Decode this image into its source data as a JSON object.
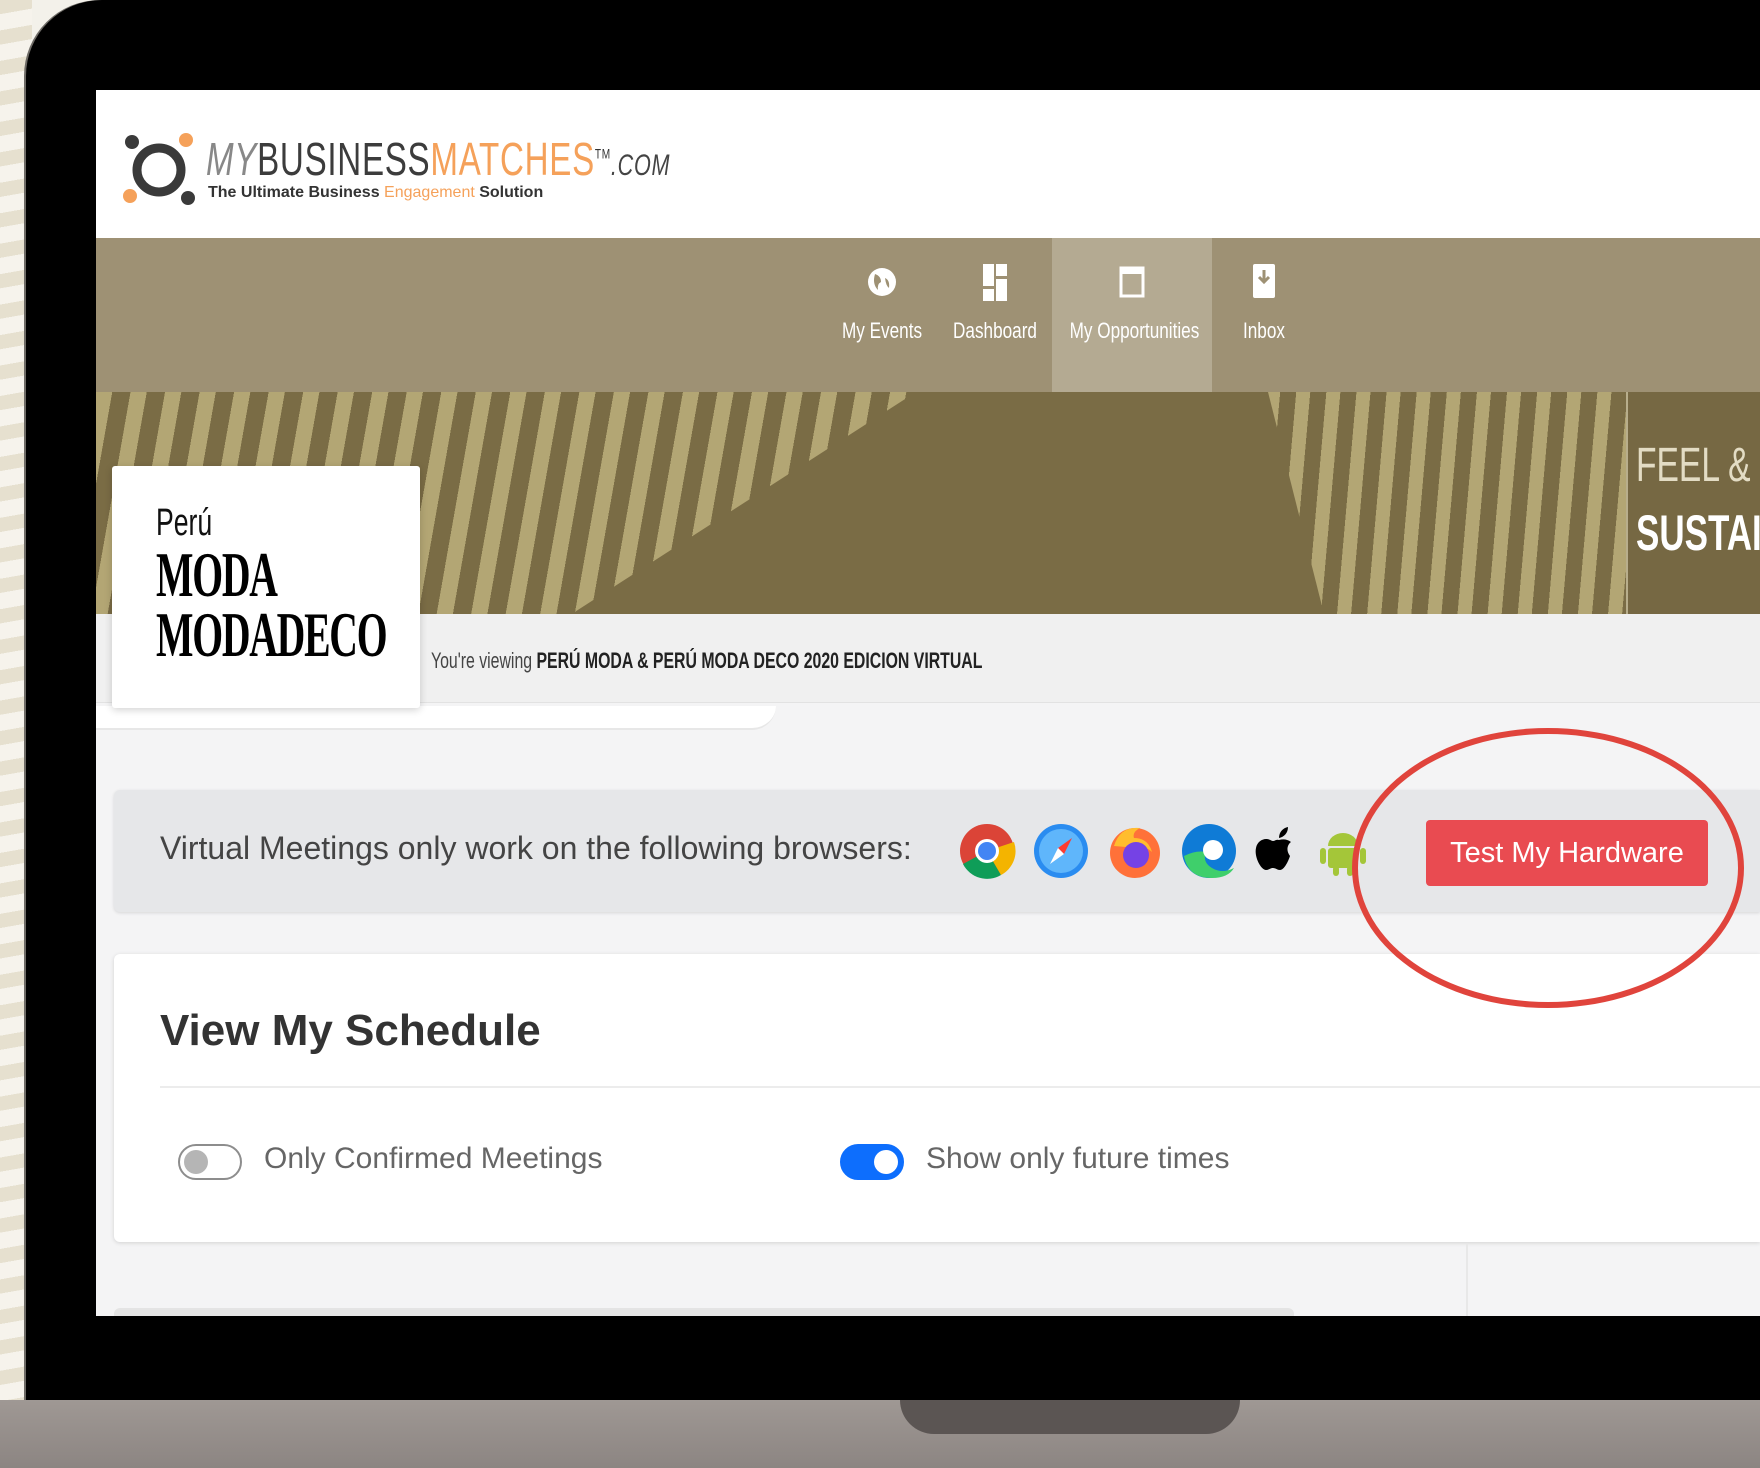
{
  "header": {
    "logo_my": "MY",
    "logo_business": "BUSINESS",
    "logo_matches": "MATCHES",
    "logo_tm": "TM",
    "logo_com": ".COM",
    "tagline_a": "The Ultimate Business ",
    "tagline_b": "Engagement",
    "tagline_c": " Solution"
  },
  "nav": {
    "items": [
      {
        "label": "My Events",
        "icon": "globe-icon"
      },
      {
        "label": "Dashboard",
        "icon": "dashboard-icon"
      },
      {
        "label": "My Opportunities",
        "icon": "folder-icon",
        "active": true
      },
      {
        "label": "Inbox",
        "icon": "inbox-icon"
      }
    ]
  },
  "banner": {
    "line1": "FEEL &",
    "line2": "SUSTAI"
  },
  "event": {
    "logo_line1": "Perú",
    "logo_line2": "MODA",
    "logo_line3": "MODADECO",
    "viewing_prefix": "You're viewing ",
    "viewing_name": "PERÚ MODA & PERÚ MODA DECO 2020 EDICION VIRTUAL"
  },
  "browsers": {
    "text": "Virtual Meetings only work on the following browsers:",
    "icons": [
      "chrome-icon",
      "safari-icon",
      "firefox-icon",
      "edge-icon",
      "apple-icon",
      "android-icon"
    ],
    "test_button": "Test My Hardware"
  },
  "schedule": {
    "title": "View My Schedule",
    "toggle_confirmed_label": "Only Confirmed Meetings",
    "toggle_confirmed_on": false,
    "toggle_future_label": "Show only future times",
    "toggle_future_on": true
  },
  "colors": {
    "nav_bg": "#9e9174",
    "nav_active": "#b4aa92",
    "accent_orange": "#f5a15a",
    "button_red": "#e94b51",
    "toggle_blue": "#0d6efd",
    "annotation_red": "#e0443c"
  }
}
